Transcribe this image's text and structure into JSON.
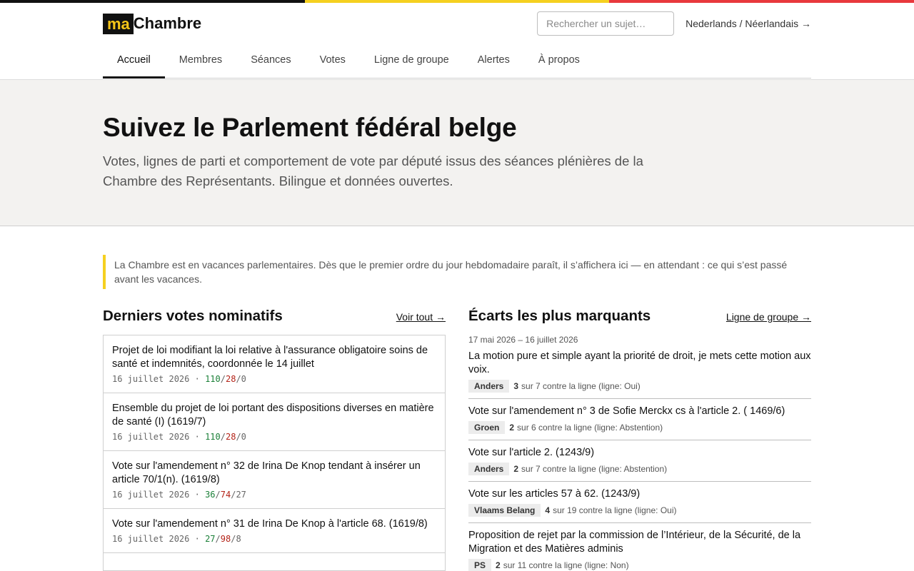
{
  "brand": {
    "logo_ma": "ma",
    "logo_name": "Chambre",
    "flag_colors": [
      "#111111",
      "#f5d020",
      "#e8383d"
    ]
  },
  "header": {
    "search_placeholder": "Rechercher un sujet…",
    "lang_link": "Nederlands / Néerlandais →"
  },
  "nav": {
    "items": [
      "Accueil",
      "Membres",
      "Séances",
      "Votes",
      "Ligne de groupe",
      "Alertes",
      "À propos"
    ],
    "active": "Accueil"
  },
  "hero": {
    "title": "Suivez le Parlement fédéral belge",
    "subtitle": "Votes, lignes de parti et comportement de vote par député issus des séances plénières de la Chambre des Représentants. Bilingue et données ouvertes."
  },
  "notice": "La Chambre est en vacances parlementaires. Dès que le premier ordre du jour hebdomadaire paraît, il s’affichera ici — en attendant : ce qui s’est passé avant les vacances.",
  "latest_votes": {
    "heading": "Derniers votes nominatifs",
    "see_all": "Voir tout →",
    "items": [
      {
        "title": "Projet de loi modifiant la loi relative à l'assurance obligatoire soins de santé et indemnités, coordonnée le 14 juillet",
        "date": "16 juillet 2026",
        "yes": "110",
        "no": "28",
        "abstain": "0"
      },
      {
        "title": "Ensemble du projet de loi portant des dispositions diverses en matière de santé (I) (1619/7)",
        "date": "16 juillet 2026",
        "yes": "110",
        "no": "28",
        "abstain": "0"
      },
      {
        "title": "Vote sur l'amendement n° 32 de Irina De Knop tendant à insérer un article 70/1(n). (1619/8)",
        "date": "16 juillet 2026",
        "yes": "36",
        "no": "74",
        "abstain": "27"
      },
      {
        "title": "Vote sur l'amendement n° 31 de Irina De Knop à l'article 68. (1619/8)",
        "date": "16 juillet 2026",
        "yes": "27",
        "no": "98",
        "abstain": "8"
      }
    ]
  },
  "deviations": {
    "heading": "Écarts les plus marquants",
    "link": "Ligne de groupe →",
    "period": "17 mai 2026 – 16 juillet 2026",
    "items": [
      {
        "title": "La motion pure et simple ayant la priorité de droit, je mets cette motion aux voix.",
        "party": "Anders",
        "count": "3",
        "detail": "sur 7 contre la ligne (ligne: Oui)"
      },
      {
        "title": "Vote sur l'amendement n° 3 de Sofie Merckx cs à l'article 2. ( 1469/6)",
        "party": "Groen",
        "count": "2",
        "detail": "sur 6 contre la ligne (ligne: Abstention)"
      },
      {
        "title": "Vote sur l'article 2. (1243/9)",
        "party": "Anders",
        "count": "2",
        "detail": "sur 7 contre la ligne (ligne: Abstention)"
      },
      {
        "title": "Vote sur les articles 57 à 62. (1243/9)",
        "party": "Vlaams Belang",
        "count": "4",
        "detail": "sur 19 contre la ligne (ligne: Oui)"
      },
      {
        "title": "Proposition de rejet par la commission de l’Intérieur, de la Sécurité, de la Migration et des Matières adminis",
        "party": "PS",
        "count": "2",
        "detail": "sur 11 contre la ligne (ligne: Non)"
      }
    ]
  }
}
